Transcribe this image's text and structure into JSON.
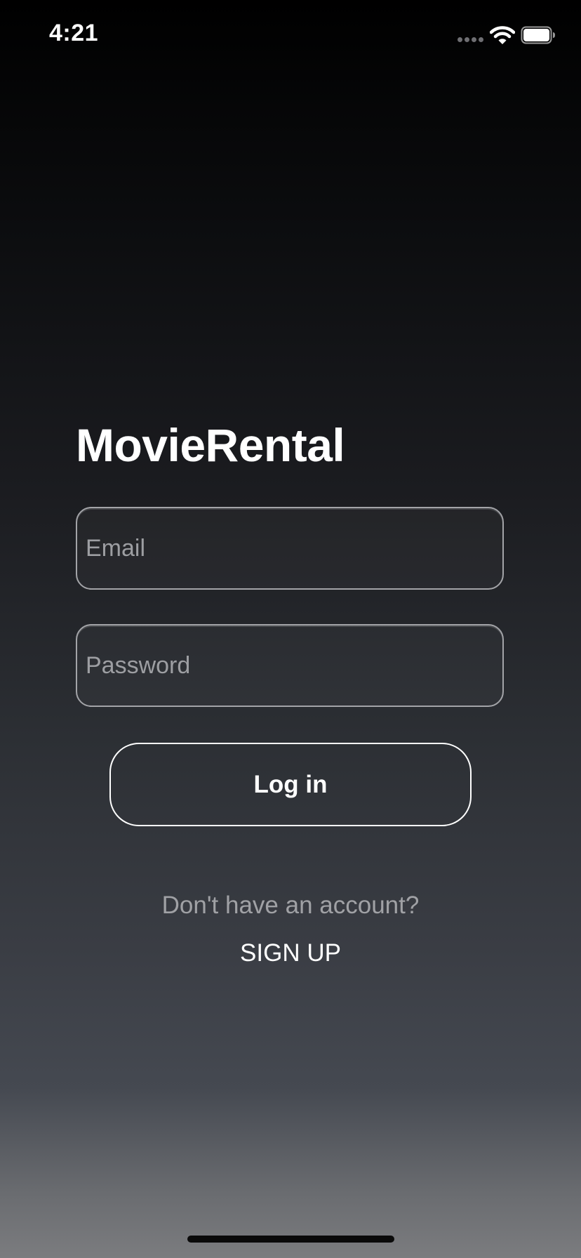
{
  "status_bar": {
    "time": "4:21",
    "icons": [
      "signal-dots-icon",
      "wifi-icon",
      "battery-icon"
    ]
  },
  "app": {
    "title": "MovieRental"
  },
  "form": {
    "email": {
      "placeholder": "Email",
      "value": ""
    },
    "password": {
      "placeholder": "Password",
      "value": ""
    },
    "login_label": "Log in"
  },
  "signup": {
    "prompt": "Don't have an account?",
    "link_label": "SIGN UP"
  },
  "colors": {
    "background_top": "#000000",
    "background_bottom": "#7b7c7f",
    "text_primary": "#ffffff",
    "text_secondary": "#a0a1a5",
    "field_border": "#a3a4a8"
  }
}
